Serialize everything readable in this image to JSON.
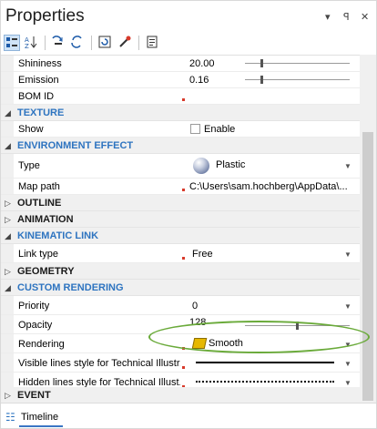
{
  "window": {
    "title": "Properties",
    "controls": {
      "dropdown": "▾",
      "pin": "ꟼ",
      "close": "✕"
    }
  },
  "toolbar": {
    "icons": [
      "categorized-icon",
      "alphabetical-icon",
      "expand-icon",
      "collapse-icon",
      "reset-icon",
      "pick-icon",
      "properties-page-icon"
    ]
  },
  "rows": {
    "shininess": {
      "name": "Shininess",
      "value": "20.00",
      "slider_fraction": 0.16
    },
    "emission": {
      "name": "Emission",
      "value": "0.16",
      "slider_fraction": 0.16
    },
    "bom_id": {
      "name": "BOM ID",
      "value": ""
    },
    "texture_show": {
      "name": "Show",
      "value": "Enable",
      "checked": false
    },
    "type": {
      "name": "Type",
      "value": "Plastic"
    },
    "map_path": {
      "name": "Map path",
      "value": "C:\\Users\\sam.hochberg\\AppData\\..."
    },
    "link_type": {
      "name": "Link type",
      "value": "Free"
    },
    "priority": {
      "name": "Priority",
      "value": "0"
    },
    "opacity": {
      "name": "Opacity",
      "value": "128",
      "slider_fraction": 0.5
    },
    "rendering": {
      "name": "Rendering",
      "value": "Smooth"
    },
    "visible_lines": {
      "name": "Visible lines style for Technical Illustr..."
    },
    "hidden_lines": {
      "name": "Hidden lines style for Technical Illust..."
    }
  },
  "categories": {
    "texture": "TEXTURE",
    "environment_effect": "ENVIRONMENT EFFECT",
    "outline": "OUTLINE",
    "animation": "ANIMATION",
    "kinematic_link": "KINEMATIC LINK",
    "geometry": "GEOMETRY",
    "custom_rendering": "CUSTOM RENDERING",
    "event": "EVENT"
  },
  "bottom": {
    "tab_label": "Timeline"
  },
  "colors": {
    "category_blue": "#2e74c0",
    "highlight_ellipse": "#6aaa3a",
    "red_marker": "#d83a2b"
  }
}
